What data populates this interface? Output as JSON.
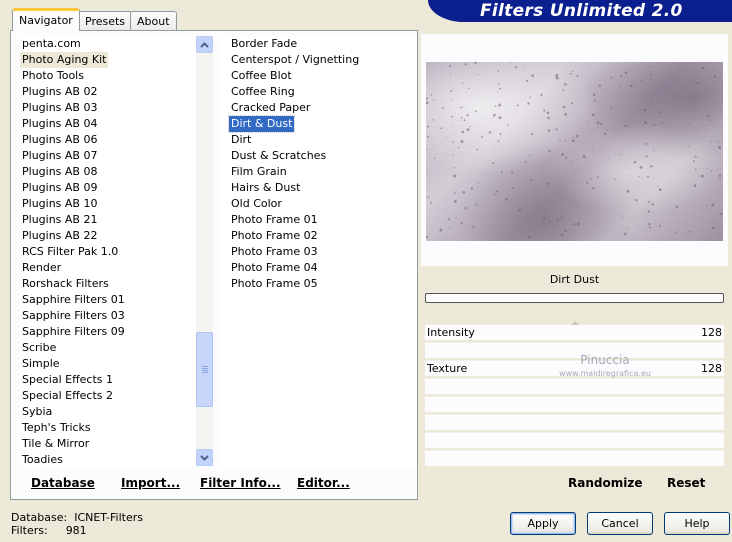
{
  "tabs": [
    {
      "label": "Navigator",
      "active": true
    },
    {
      "label": "Presets",
      "active": false
    },
    {
      "label": "About",
      "active": false
    }
  ],
  "title": "Filters Unlimited 2.0",
  "categories": {
    "items": [
      "penta.com",
      "Photo Aging Kit",
      "Photo Tools",
      "Plugins AB 02",
      "Plugins AB 03",
      "Plugins AB 04",
      "Plugins AB 06",
      "Plugins AB 07",
      "Plugins AB 08",
      "Plugins AB 09",
      "Plugins AB 10",
      "Plugins AB 21",
      "Plugins AB 22",
      "RCS Filter Pak 1.0",
      "Render",
      "Rorshack Filters",
      "Sapphire Filters 01",
      "Sapphire Filters 03",
      "Sapphire Filters 09",
      "Scribe",
      "Simple",
      "Special Effects 1",
      "Special Effects 2",
      "Sybia",
      "Teph's Tricks",
      "Tile & Mirror",
      "Toadies"
    ],
    "selected": "Photo Aging Kit"
  },
  "filters": {
    "items": [
      "Border Fade",
      "Centerspot / Vignetting",
      "Coffee Blot",
      "Coffee Ring",
      "Cracked Paper",
      "Dirt & Dust",
      "Dirt",
      "Dust & Scratches",
      "Film Grain",
      "Hairs & Dust",
      "Old Color",
      "Photo Frame 01",
      "Photo Frame 02",
      "Photo Frame 03",
      "Photo Frame 04",
      "Photo Frame 05"
    ],
    "selected": "Dirt & Dust"
  },
  "left_buttons": {
    "database": "Database",
    "import": "Import...",
    "filter_info": "Filter Info...",
    "editor": "Editor..."
  },
  "preview": {
    "filter_name": "Dirt  Dust",
    "progress": 0
  },
  "params": [
    {
      "label": "Intensity",
      "value": "128"
    },
    {
      "label": "Texture",
      "value": "128"
    }
  ],
  "watermark": {
    "name": "Pinuccia",
    "site": "www.maidiregrafica.eu"
  },
  "right_buttons": {
    "randomize": "Randomize",
    "reset": "Reset"
  },
  "status": {
    "database_label": "Database:",
    "database_value": "ICNET-Filters",
    "filters_label": "Filters:",
    "filters_value": "981"
  },
  "dialog_buttons": {
    "apply": "Apply",
    "cancel": "Cancel",
    "help": "Help"
  },
  "colors": {
    "banner": "#0b1f8f",
    "selection": "#316ac5",
    "background": "#ece9d8"
  }
}
